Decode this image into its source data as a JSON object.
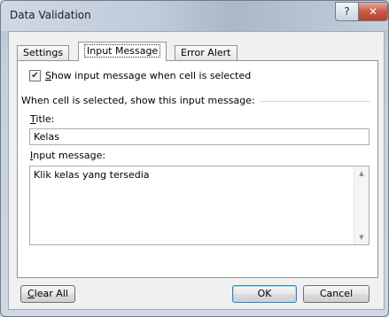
{
  "window": {
    "title": "Data Validation",
    "help_glyph": "?",
    "close_glyph": "✕"
  },
  "tabs": [
    {
      "label": "Settings",
      "active": false
    },
    {
      "label": "Input Message",
      "active": true
    },
    {
      "label": "Error Alert",
      "active": false
    }
  ],
  "input_message": {
    "show_checkbox": {
      "checked": true,
      "mnemonic": "S",
      "label_rest": "how input message when cell is selected"
    },
    "group_label": "When cell is selected, show this input message:",
    "title_label": {
      "mnemonic": "T",
      "rest": "itle:"
    },
    "title_value": "Kelas",
    "message_label": {
      "mnemonic": "I",
      "rest": "nput message:"
    },
    "message_value": "Klik kelas yang tersedia"
  },
  "buttons": {
    "clear_all": {
      "mnemonic": "C",
      "rest": "lear All"
    },
    "ok": "OK",
    "cancel": "Cancel"
  }
}
